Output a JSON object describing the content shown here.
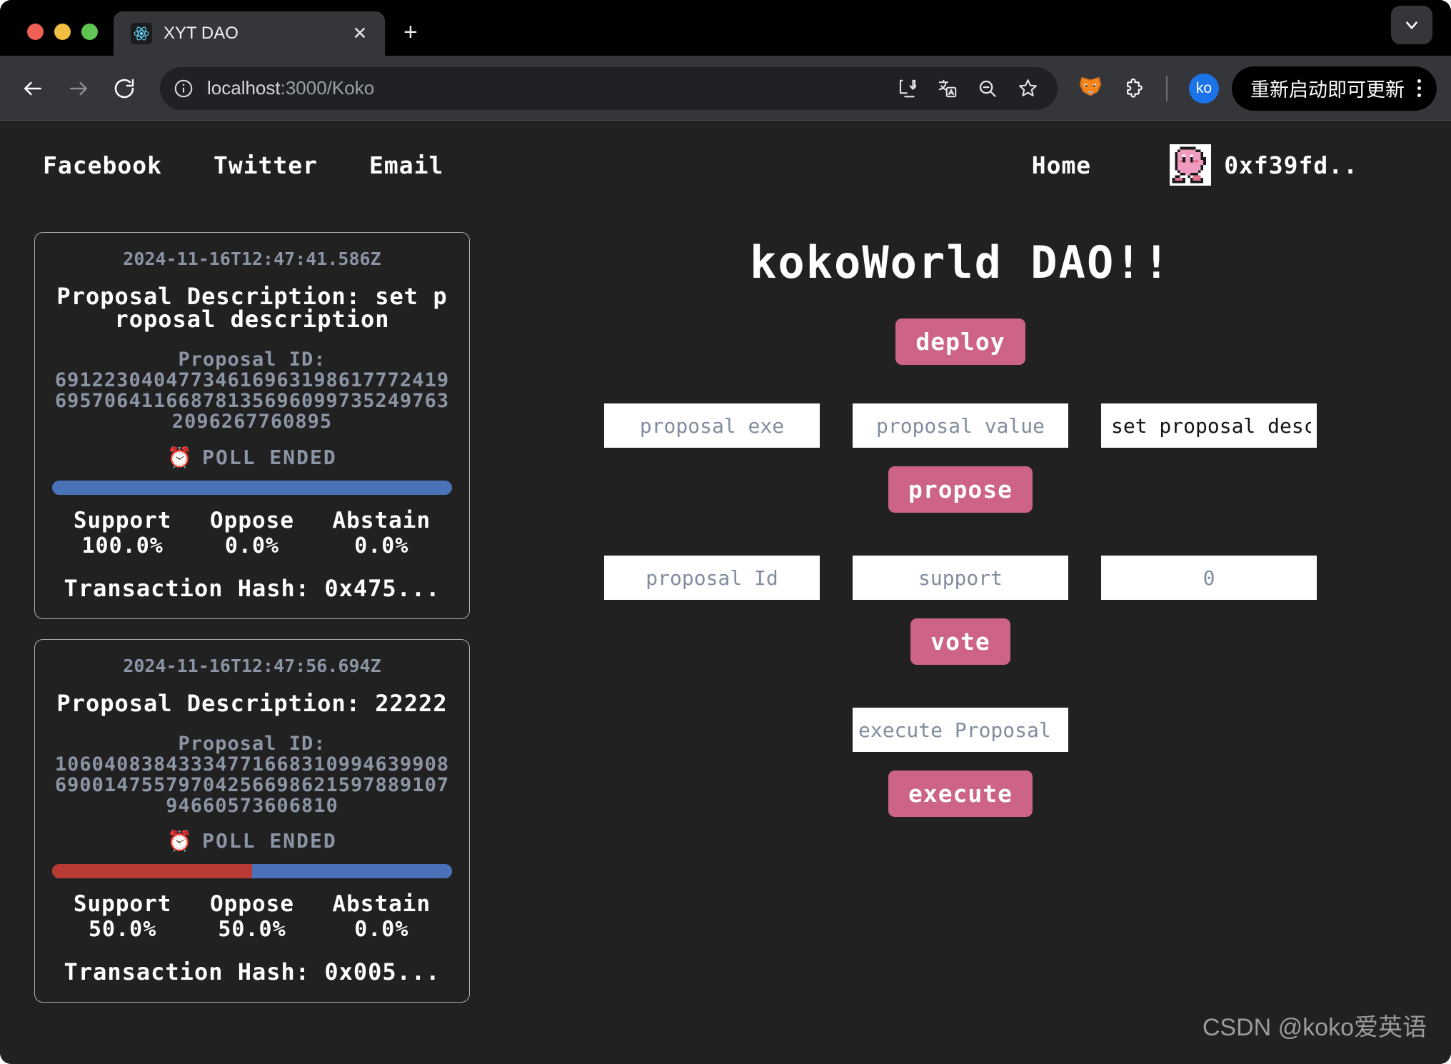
{
  "browser": {
    "tab": {
      "title": "XYT DAO",
      "favicon": "react-icon",
      "close": "✕"
    },
    "new_tab_label": "+",
    "url_prefix": "localhost",
    "url_suffix": ":3000/Koko",
    "update_button_label": "重新启动即可更新",
    "profile_initials": "ko",
    "icons": {
      "back": "back-arrow-icon",
      "forward": "forward-arrow-icon",
      "reload": "reload-icon",
      "info": "info-icon",
      "install": "install-app-icon",
      "translate": "translate-icon",
      "zoom_out": "zoom-out-icon",
      "bookmark": "bookmark-star-icon",
      "metamask": "metamask-fox-icon",
      "extensions": "extensions-puzzle-icon",
      "chevron": "chevron-down-icon",
      "menu": "three-dot-menu-icon"
    }
  },
  "nav": {
    "links": [
      {
        "label": "Facebook"
      },
      {
        "label": "Twitter"
      },
      {
        "label": "Email"
      }
    ],
    "home_label": "Home",
    "wallet_address": "0xf39fd..",
    "avatar": "kirby-avatar"
  },
  "dao": {
    "title": "kokoWorld DAO!!",
    "deploy_label": "deploy",
    "propose": {
      "fields": [
        {
          "name": "proposal-exe",
          "placeholder": "proposal exe",
          "value": ""
        },
        {
          "name": "proposal-value",
          "placeholder": "proposal value",
          "value": ""
        },
        {
          "name": "set-proposal-description",
          "placeholder": "set proposal description",
          "value": "set proposal description"
        }
      ],
      "button_label": "propose"
    },
    "vote": {
      "fields": [
        {
          "name": "proposal-id",
          "placeholder": "proposal Id",
          "value": ""
        },
        {
          "name": "support",
          "placeholder": "support",
          "value": ""
        },
        {
          "name": "vote-amount",
          "placeholder": "0",
          "value": ""
        }
      ],
      "button_label": "vote"
    },
    "execute": {
      "fields": [
        {
          "name": "execute-proposal-id",
          "placeholder": "execute Proposal Id",
          "value": ""
        }
      ],
      "button_label": "execute"
    }
  },
  "proposals": [
    {
      "timestamp": "2024-11-16T12:47:41.586Z",
      "description_label": "Proposal Description:",
      "description": "set proposal description",
      "id_label": "Proposal ID:",
      "id": "69122304047734616963198617772419695706411668781356960997352497632096267760895",
      "status": "POLL ENDED",
      "status_icon": "alarm-clock-icon",
      "support_pct": 100.0,
      "oppose_pct": 0.0,
      "abstain_pct": 0.0,
      "support_label": "Support",
      "oppose_label": "Oppose",
      "abstain_label": "Abstain",
      "support_value": "100.0%",
      "oppose_value": "0.0%",
      "abstain_value": "0.0%",
      "tx_hash": "Transaction Hash: 0x475..."
    },
    {
      "timestamp": "2024-11-16T12:47:56.694Z",
      "description_label": "Proposal Description:",
      "description": "22222",
      "id_label": "Proposal ID:",
      "id": "106040838433347716683109946399086900147557970425669862159788910794660573606810",
      "status": "POLL ENDED",
      "status_icon": "alarm-clock-icon",
      "support_pct": 50.0,
      "oppose_pct": 50.0,
      "abstain_pct": 0.0,
      "support_label": "Support",
      "oppose_label": "Oppose",
      "abstain_label": "Abstain",
      "support_value": "50.0%",
      "oppose_value": "50.0%",
      "abstain_value": "0.0%",
      "tx_hash": "Transaction Hash: 0x005..."
    }
  ],
  "watermark": "CSDN @koko爱英语",
  "colors": {
    "page_bg": "#212121",
    "accent_pink": "#cd6385",
    "support_blue": "#4a72b8",
    "oppose_red": "#b93b34",
    "muted_text": "#8b95a6"
  }
}
